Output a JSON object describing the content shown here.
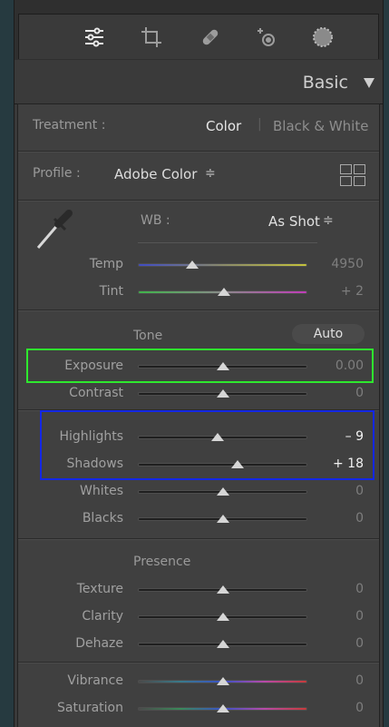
{
  "toolbar": {
    "tools": [
      {
        "icon": "edit-sliders-icon"
      },
      {
        "icon": "crop-icon"
      },
      {
        "icon": "healing-bandage-icon"
      },
      {
        "icon": "redeye-icon"
      },
      {
        "icon": "masking-circle-icon"
      }
    ]
  },
  "header": {
    "title": "Basic"
  },
  "treatment": {
    "label": "Treatment :",
    "color": "Color",
    "bw": "Black & White"
  },
  "profile": {
    "label": "Profile :",
    "value": "Adobe Color",
    "arrows": "≑"
  },
  "wb": {
    "label": "WB :",
    "value": "As Shot",
    "arrows": "≑"
  },
  "sliders": {
    "temp": {
      "label": "Temp",
      "value": "4950",
      "pos": 0.32
    },
    "tint": {
      "label": "Tint",
      "value": "+ 2",
      "pos": 0.51
    },
    "exposure": {
      "label": "Exposure",
      "value": "0.00",
      "pos": 0.5
    },
    "contrast": {
      "label": "Contrast",
      "value": "0",
      "pos": 0.5
    },
    "highlights": {
      "label": "Highlights",
      "value": "– 9",
      "pos": 0.47
    },
    "shadows": {
      "label": "Shadows",
      "value": "+ 18",
      "pos": 0.59
    },
    "whites": {
      "label": "Whites",
      "value": "0",
      "pos": 0.5
    },
    "blacks": {
      "label": "Blacks",
      "value": "0",
      "pos": 0.5
    },
    "texture": {
      "label": "Texture",
      "value": "0",
      "pos": 0.5
    },
    "clarity": {
      "label": "Clarity",
      "value": "0",
      "pos": 0.5
    },
    "dehaze": {
      "label": "Dehaze",
      "value": "0",
      "pos": 0.5
    },
    "vibrance": {
      "label": "Vibrance",
      "value": "0",
      "pos": 0.5
    },
    "saturation": {
      "label": "Saturation",
      "value": "0",
      "pos": 0.5
    }
  },
  "tone": {
    "label": "Tone",
    "auto": "Auto"
  },
  "presence": {
    "label": "Presence"
  },
  "colors": {
    "highlight_green": "#2ee82e",
    "highlight_blue": "#1327e6"
  }
}
